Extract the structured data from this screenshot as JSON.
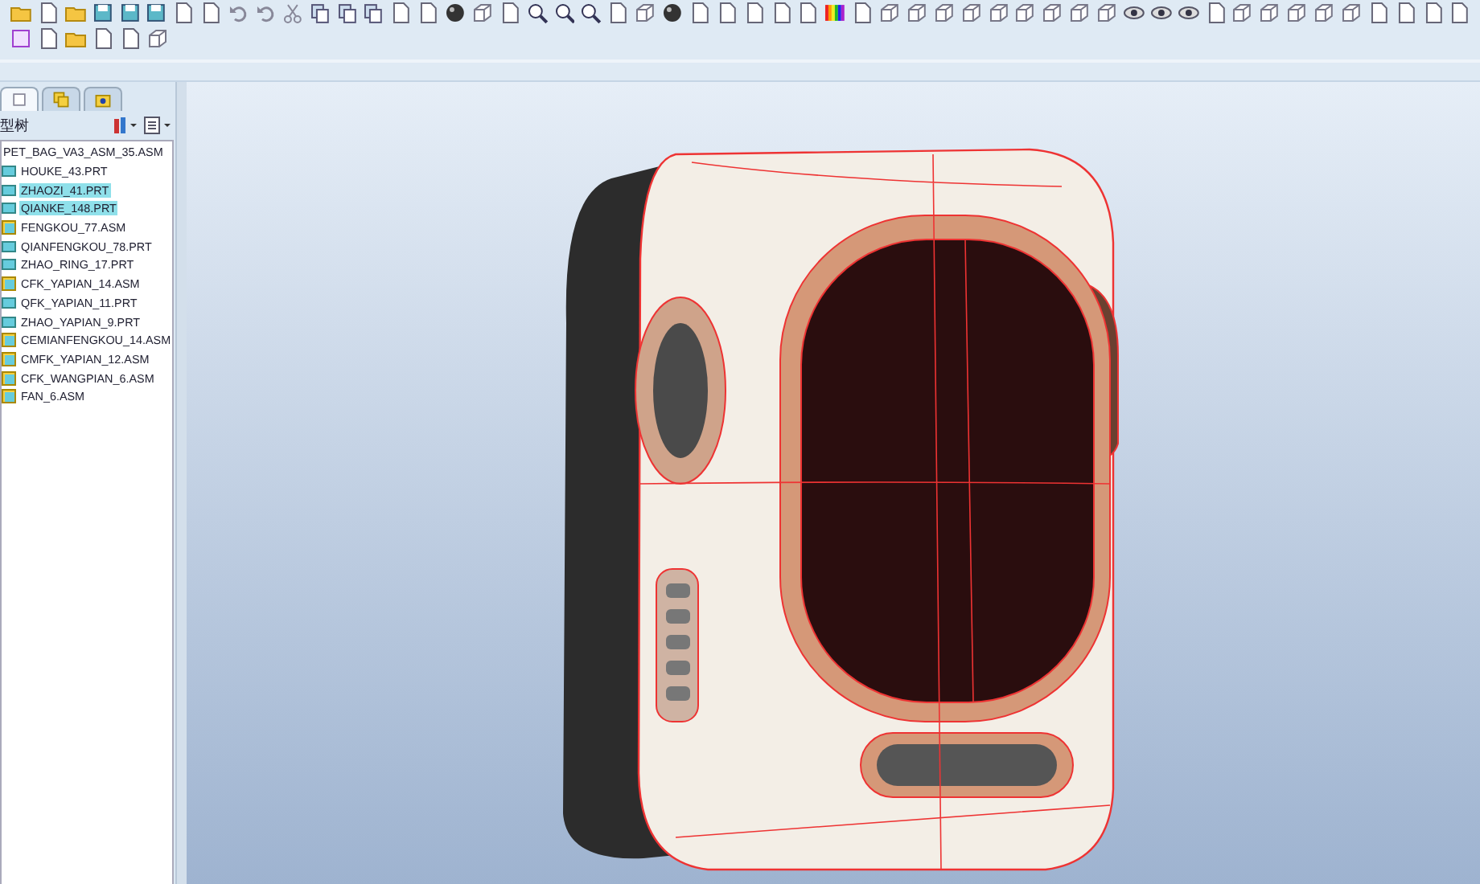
{
  "model_tree": {
    "tabs": [
      {
        "selected": true
      },
      {
        "selected": false
      },
      {
        "selected": false
      }
    ],
    "title": "型树",
    "root": {
      "label": "PET_BAG_VA3_ASM_35.ASM",
      "children": [
        {
          "label": "HOUKE_43.PRT",
          "kind": "part",
          "selected": false
        },
        {
          "label": "ZHAOZI_41.PRT",
          "kind": "part",
          "selected": true
        },
        {
          "label": "QIANKE_148.PRT",
          "kind": "part",
          "selected": true
        },
        {
          "label": "FENGKOU_77.ASM",
          "kind": "assembly",
          "selected": false
        },
        {
          "label": "QIANFENGKOU_78.PRT",
          "kind": "part",
          "selected": false
        },
        {
          "label": "ZHAO_RING_17.PRT",
          "kind": "part",
          "selected": false
        },
        {
          "label": "CFK_YAPIAN_14.ASM",
          "kind": "assembly",
          "selected": false
        },
        {
          "label": "QFK_YAPIAN_11.PRT",
          "kind": "part",
          "selected": false
        },
        {
          "label": "ZHAO_YAPIAN_9.PRT",
          "kind": "part",
          "selected": false
        },
        {
          "label": "CEMIANFENGKOU_14.ASM",
          "kind": "assembly",
          "selected": false
        },
        {
          "label": "CMFK_YAPIAN_12.ASM",
          "kind": "assembly",
          "selected": false
        },
        {
          "label": "CFK_WANGPIAN_6.ASM",
          "kind": "assembly",
          "selected": false
        },
        {
          "label": "FAN_6.ASM",
          "kind": "assembly",
          "selected": false
        }
      ]
    }
  }
}
